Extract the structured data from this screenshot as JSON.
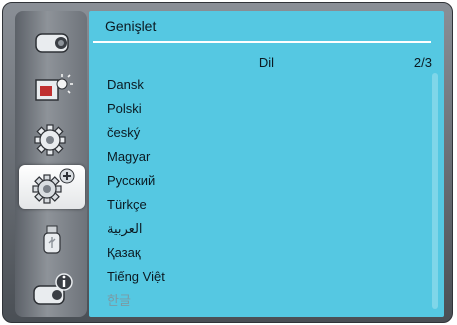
{
  "menu": {
    "title": "Genişlet",
    "submenu_title": "Dil",
    "page_indicator": "2/3"
  },
  "languages": [
    {
      "label": "Dansk"
    },
    {
      "label": "Polski"
    },
    {
      "label": "český"
    },
    {
      "label": "Magyar"
    },
    {
      "label": "Русский"
    },
    {
      "label": "Türkçe"
    },
    {
      "label": "العربية"
    },
    {
      "label": "Қазақ"
    },
    {
      "label": "Tiếng Việt"
    },
    {
      "label": "한글"
    }
  ],
  "sidebar": {
    "tabs": [
      {
        "icon": "display-icon"
      },
      {
        "icon": "image-adjust-icon"
      },
      {
        "icon": "settings-gear-icon"
      },
      {
        "icon": "expand-settings-icon",
        "active": true
      },
      {
        "icon": "usb-icon"
      },
      {
        "icon": "info-icon"
      }
    ]
  },
  "colors": {
    "panel": "#55c8e2",
    "sidebar": "#8e9399",
    "frame": "#5a5f66"
  }
}
